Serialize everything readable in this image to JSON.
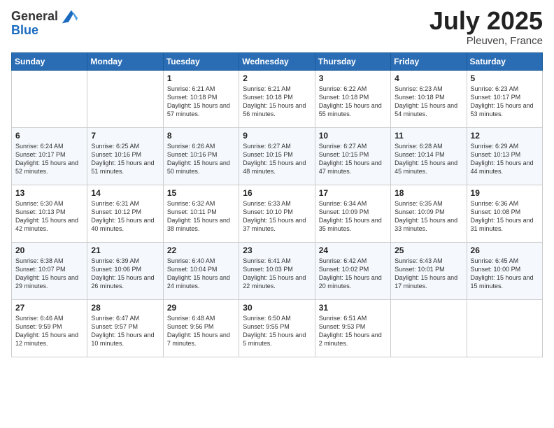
{
  "logo": {
    "general": "General",
    "blue": "Blue"
  },
  "title": {
    "month": "July 2025",
    "location": "Pleuven, France"
  },
  "headers": [
    "Sunday",
    "Monday",
    "Tuesday",
    "Wednesday",
    "Thursday",
    "Friday",
    "Saturday"
  ],
  "weeks": [
    [
      {
        "day": "",
        "sunrise": "",
        "sunset": "",
        "daylight": ""
      },
      {
        "day": "",
        "sunrise": "",
        "sunset": "",
        "daylight": ""
      },
      {
        "day": "1",
        "sunrise": "Sunrise: 6:21 AM",
        "sunset": "Sunset: 10:18 PM",
        "daylight": "Daylight: 15 hours and 57 minutes."
      },
      {
        "day": "2",
        "sunrise": "Sunrise: 6:21 AM",
        "sunset": "Sunset: 10:18 PM",
        "daylight": "Daylight: 15 hours and 56 minutes."
      },
      {
        "day": "3",
        "sunrise": "Sunrise: 6:22 AM",
        "sunset": "Sunset: 10:18 PM",
        "daylight": "Daylight: 15 hours and 55 minutes."
      },
      {
        "day": "4",
        "sunrise": "Sunrise: 6:23 AM",
        "sunset": "Sunset: 10:18 PM",
        "daylight": "Daylight: 15 hours and 54 minutes."
      },
      {
        "day": "5",
        "sunrise": "Sunrise: 6:23 AM",
        "sunset": "Sunset: 10:17 PM",
        "daylight": "Daylight: 15 hours and 53 minutes."
      }
    ],
    [
      {
        "day": "6",
        "sunrise": "Sunrise: 6:24 AM",
        "sunset": "Sunset: 10:17 PM",
        "daylight": "Daylight: 15 hours and 52 minutes."
      },
      {
        "day": "7",
        "sunrise": "Sunrise: 6:25 AM",
        "sunset": "Sunset: 10:16 PM",
        "daylight": "Daylight: 15 hours and 51 minutes."
      },
      {
        "day": "8",
        "sunrise": "Sunrise: 6:26 AM",
        "sunset": "Sunset: 10:16 PM",
        "daylight": "Daylight: 15 hours and 50 minutes."
      },
      {
        "day": "9",
        "sunrise": "Sunrise: 6:27 AM",
        "sunset": "Sunset: 10:15 PM",
        "daylight": "Daylight: 15 hours and 48 minutes."
      },
      {
        "day": "10",
        "sunrise": "Sunrise: 6:27 AM",
        "sunset": "Sunset: 10:15 PM",
        "daylight": "Daylight: 15 hours and 47 minutes."
      },
      {
        "day": "11",
        "sunrise": "Sunrise: 6:28 AM",
        "sunset": "Sunset: 10:14 PM",
        "daylight": "Daylight: 15 hours and 45 minutes."
      },
      {
        "day": "12",
        "sunrise": "Sunrise: 6:29 AM",
        "sunset": "Sunset: 10:13 PM",
        "daylight": "Daylight: 15 hours and 44 minutes."
      }
    ],
    [
      {
        "day": "13",
        "sunrise": "Sunrise: 6:30 AM",
        "sunset": "Sunset: 10:13 PM",
        "daylight": "Daylight: 15 hours and 42 minutes."
      },
      {
        "day": "14",
        "sunrise": "Sunrise: 6:31 AM",
        "sunset": "Sunset: 10:12 PM",
        "daylight": "Daylight: 15 hours and 40 minutes."
      },
      {
        "day": "15",
        "sunrise": "Sunrise: 6:32 AM",
        "sunset": "Sunset: 10:11 PM",
        "daylight": "Daylight: 15 hours and 38 minutes."
      },
      {
        "day": "16",
        "sunrise": "Sunrise: 6:33 AM",
        "sunset": "Sunset: 10:10 PM",
        "daylight": "Daylight: 15 hours and 37 minutes."
      },
      {
        "day": "17",
        "sunrise": "Sunrise: 6:34 AM",
        "sunset": "Sunset: 10:09 PM",
        "daylight": "Daylight: 15 hours and 35 minutes."
      },
      {
        "day": "18",
        "sunrise": "Sunrise: 6:35 AM",
        "sunset": "Sunset: 10:09 PM",
        "daylight": "Daylight: 15 hours and 33 minutes."
      },
      {
        "day": "19",
        "sunrise": "Sunrise: 6:36 AM",
        "sunset": "Sunset: 10:08 PM",
        "daylight": "Daylight: 15 hours and 31 minutes."
      }
    ],
    [
      {
        "day": "20",
        "sunrise": "Sunrise: 6:38 AM",
        "sunset": "Sunset: 10:07 PM",
        "daylight": "Daylight: 15 hours and 29 minutes."
      },
      {
        "day": "21",
        "sunrise": "Sunrise: 6:39 AM",
        "sunset": "Sunset: 10:06 PM",
        "daylight": "Daylight: 15 hours and 26 minutes."
      },
      {
        "day": "22",
        "sunrise": "Sunrise: 6:40 AM",
        "sunset": "Sunset: 10:04 PM",
        "daylight": "Daylight: 15 hours and 24 minutes."
      },
      {
        "day": "23",
        "sunrise": "Sunrise: 6:41 AM",
        "sunset": "Sunset: 10:03 PM",
        "daylight": "Daylight: 15 hours and 22 minutes."
      },
      {
        "day": "24",
        "sunrise": "Sunrise: 6:42 AM",
        "sunset": "Sunset: 10:02 PM",
        "daylight": "Daylight: 15 hours and 20 minutes."
      },
      {
        "day": "25",
        "sunrise": "Sunrise: 6:43 AM",
        "sunset": "Sunset: 10:01 PM",
        "daylight": "Daylight: 15 hours and 17 minutes."
      },
      {
        "day": "26",
        "sunrise": "Sunrise: 6:45 AM",
        "sunset": "Sunset: 10:00 PM",
        "daylight": "Daylight: 15 hours and 15 minutes."
      }
    ],
    [
      {
        "day": "27",
        "sunrise": "Sunrise: 6:46 AM",
        "sunset": "Sunset: 9:59 PM",
        "daylight": "Daylight: 15 hours and 12 minutes."
      },
      {
        "day": "28",
        "sunrise": "Sunrise: 6:47 AM",
        "sunset": "Sunset: 9:57 PM",
        "daylight": "Daylight: 15 hours and 10 minutes."
      },
      {
        "day": "29",
        "sunrise": "Sunrise: 6:48 AM",
        "sunset": "Sunset: 9:56 PM",
        "daylight": "Daylight: 15 hours and 7 minutes."
      },
      {
        "day": "30",
        "sunrise": "Sunrise: 6:50 AM",
        "sunset": "Sunset: 9:55 PM",
        "daylight": "Daylight: 15 hours and 5 minutes."
      },
      {
        "day": "31",
        "sunrise": "Sunrise: 6:51 AM",
        "sunset": "Sunset: 9:53 PM",
        "daylight": "Daylight: 15 hours and 2 minutes."
      },
      {
        "day": "",
        "sunrise": "",
        "sunset": "",
        "daylight": ""
      },
      {
        "day": "",
        "sunrise": "",
        "sunset": "",
        "daylight": ""
      }
    ]
  ]
}
